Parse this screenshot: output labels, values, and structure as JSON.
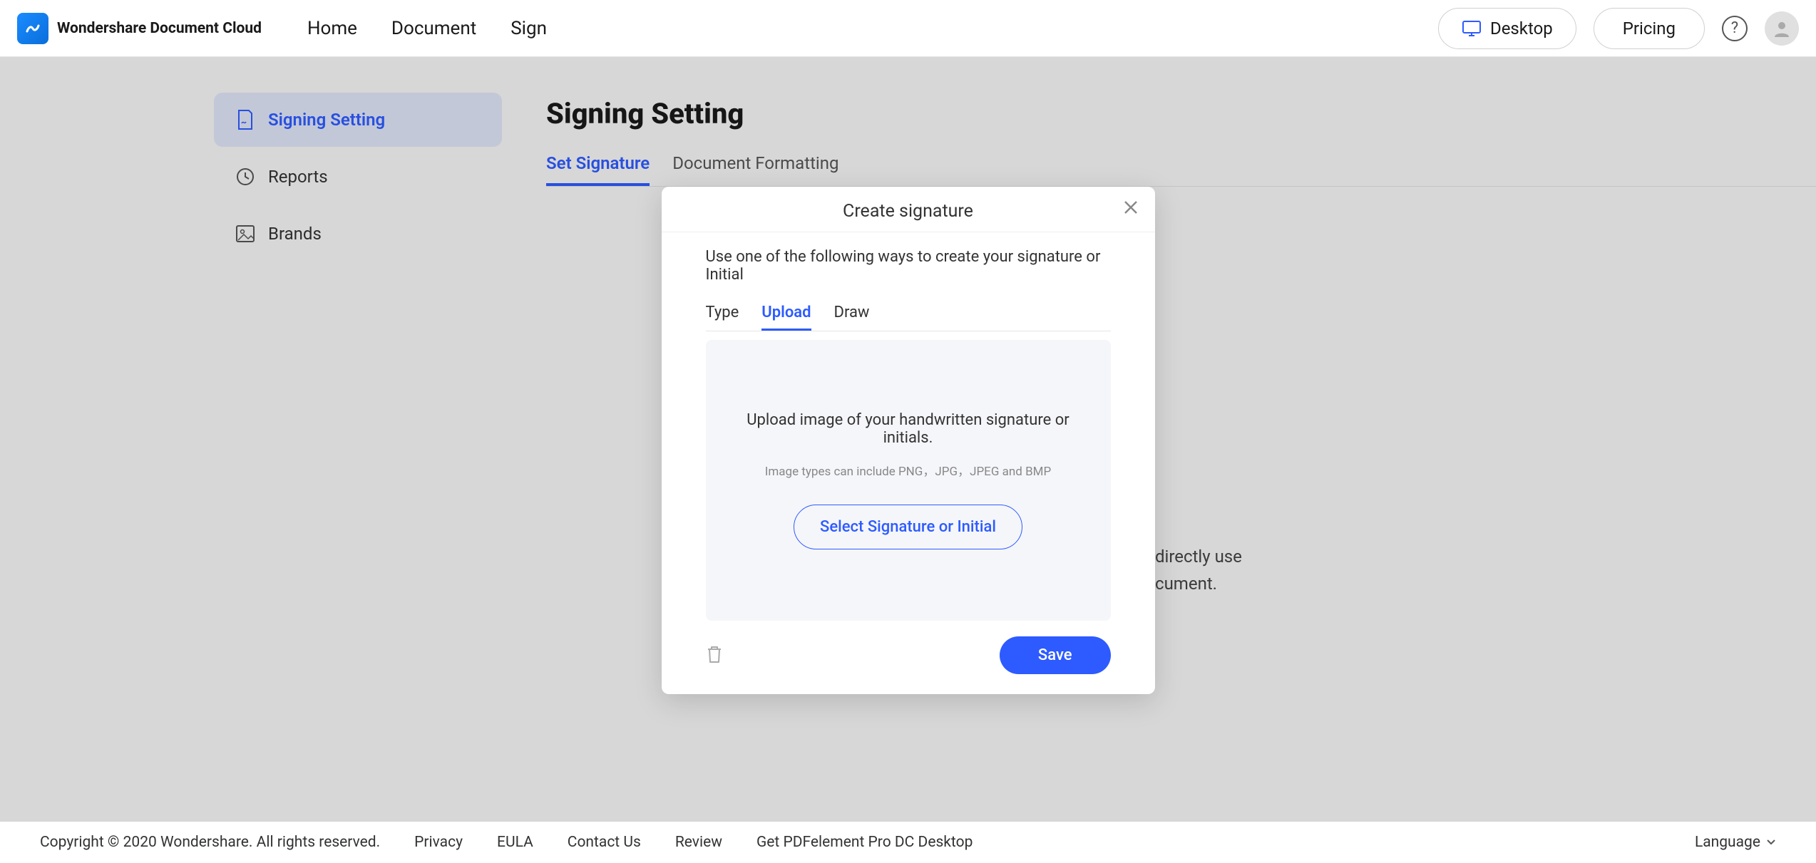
{
  "header": {
    "logo_text": "Wondershare Document Cloud",
    "nav": {
      "home": "Home",
      "document": "Document",
      "sign": "Sign"
    },
    "desktop_btn": "Desktop",
    "pricing_btn": "Pricing",
    "help_glyph": "?"
  },
  "sidebar": {
    "items": [
      {
        "label": "Signing Setting",
        "active": true
      },
      {
        "label": "Reports",
        "active": false
      },
      {
        "label": "Brands",
        "active": false
      }
    ]
  },
  "page": {
    "title": "Signing Setting",
    "tabs": [
      {
        "label": "Set Signature",
        "active": true
      },
      {
        "label": "Document Formatting",
        "active": false
      }
    ],
    "bg_text_line1_frag": "directly use",
    "bg_text_line2_frag": "cument."
  },
  "modal": {
    "title": "Create signature",
    "instruction": "Use one of the following ways to create your signature or Initial",
    "method_tabs": [
      {
        "label": "Type",
        "active": false
      },
      {
        "label": "Upload",
        "active": true
      },
      {
        "label": "Draw",
        "active": false
      }
    ],
    "upload_main": "Upload image of your handwritten signature or initials.",
    "upload_sub": "Image types can include PNG，JPG，JPEG and BMP",
    "select_btn": "Select Signature or Initial",
    "save_btn": "Save"
  },
  "footer": {
    "copyright": "Copyright © 2020 Wondershare. All rights reserved.",
    "links": {
      "privacy": "Privacy",
      "eula": "EULA",
      "contact": "Contact Us",
      "review": "Review",
      "get_desktop": "Get PDFelement Pro DC Desktop"
    },
    "language": "Language"
  }
}
